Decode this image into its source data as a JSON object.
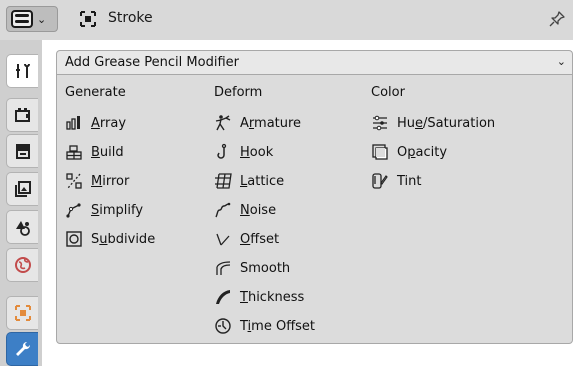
{
  "header": {
    "context_title": "Stroke"
  },
  "dropdown": {
    "label": "Add Grease Pencil Modifier"
  },
  "columns": {
    "generate": {
      "heading": "Generate",
      "items": [
        {
          "pre": "",
          "u": "A",
          "post": "rray",
          "icon": "array-icon"
        },
        {
          "pre": "",
          "u": "B",
          "post": "uild",
          "icon": "build-icon"
        },
        {
          "pre": "",
          "u": "M",
          "post": "irror",
          "icon": "mirror-icon"
        },
        {
          "pre": "",
          "u": "S",
          "post": "implify",
          "icon": "simplify-icon"
        },
        {
          "pre": "S",
          "u": "u",
          "post": "bdivide",
          "icon": "subdivide-icon"
        }
      ]
    },
    "deform": {
      "heading": "Deform",
      "items": [
        {
          "pre": "A",
          "u": "r",
          "post": "mature",
          "icon": "armature-icon"
        },
        {
          "pre": "",
          "u": "H",
          "post": "ook",
          "icon": "hook-icon"
        },
        {
          "pre": "",
          "u": "L",
          "post": "attice",
          "icon": "lattice-icon"
        },
        {
          "pre": "",
          "u": "N",
          "post": "oise",
          "icon": "noise-icon"
        },
        {
          "pre": "",
          "u": "O",
          "post": "ffset",
          "icon": "offset-icon"
        },
        {
          "pre": "Smooth",
          "u": "",
          "post": "",
          "icon": "smooth-icon"
        },
        {
          "pre": "",
          "u": "T",
          "post": "hickness",
          "icon": "thickness-icon"
        },
        {
          "pre": "T",
          "u": "i",
          "post": "me Offset",
          "icon": "time-offset-icon"
        }
      ]
    },
    "color": {
      "heading": "Color",
      "items": [
        {
          "pre": "Hu",
          "u": "e",
          "post": "/Saturation",
          "icon": "hue-saturation-icon"
        },
        {
          "pre": "O",
          "u": "p",
          "post": "acity",
          "icon": "opacity-icon"
        },
        {
          "pre": "Tint",
          "u": "",
          "post": "",
          "icon": "tint-icon"
        }
      ]
    }
  },
  "tabs": [
    {
      "name": "tab-tool",
      "icon": "tool-icon"
    },
    {
      "name": "tab-render",
      "icon": "render-icon"
    },
    {
      "name": "tab-output",
      "icon": "output-icon"
    },
    {
      "name": "tab-view-layer",
      "icon": "view-layer-icon"
    },
    {
      "name": "tab-scene",
      "icon": "scene-icon"
    },
    {
      "name": "tab-world",
      "icon": "world-icon"
    },
    {
      "name": "tab-object",
      "icon": "object-icon"
    },
    {
      "name": "tab-modifiers",
      "icon": "wrench-icon"
    }
  ]
}
